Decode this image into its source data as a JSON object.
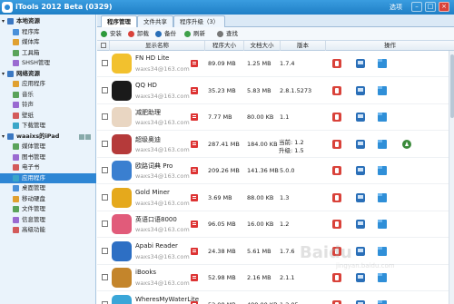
{
  "window": {
    "title": "iTools 2012 Beta (0329)",
    "options_label": "选项",
    "min_label": "–",
    "max_label": "□",
    "close_label": "×"
  },
  "sidebar": {
    "groups": [
      {
        "label": "本地资源",
        "items": [
          "程序库",
          "媒体库",
          "工具箱",
          "SHSH管理"
        ]
      },
      {
        "label": "网络资源",
        "items": [
          "应用程序",
          "音乐",
          "铃声",
          "壁纸",
          "下载管理"
        ]
      },
      {
        "label": "waaixs的iPad",
        "items": [
          "媒体管理",
          "图书管理",
          "电子书",
          "应用程序",
          "桌面管理",
          "移动硬盘",
          "文件管理",
          "信息管理",
          "高级功能"
        ]
      }
    ],
    "selected": "应用程序"
  },
  "tabs": [
    {
      "label": "程序管理",
      "active": true
    },
    {
      "label": "文件共享",
      "active": false
    },
    {
      "label": "程序升级（3）",
      "active": false
    }
  ],
  "toolbar": [
    {
      "label": "安装",
      "icon": "install-icon",
      "color": "#2e9a3a"
    },
    {
      "label": "卸载",
      "icon": "uninstall-icon",
      "color": "#d9423a"
    },
    {
      "label": "备份",
      "icon": "backup-icon",
      "color": "#2a6fb8"
    },
    {
      "label": "刷新",
      "icon": "refresh-icon",
      "color": "#3fa14a"
    },
    {
      "label": "查找",
      "icon": "search-icon",
      "color": "#777777"
    }
  ],
  "columns": [
    "显示名称",
    "程序大小",
    "文档大小",
    "版本",
    "操作"
  ],
  "apps": [
    {
      "name": "FN HD Lite",
      "account": "waxs34@163.com",
      "program_size": "89.09 MB",
      "doc_size": "1.25 MB",
      "version": "1.7.4",
      "version2": "",
      "upgrade": false,
      "icon_color": "#f2c12e"
    },
    {
      "name": "QQ HD",
      "account": "waxs34@163.com",
      "program_size": "35.23 MB",
      "doc_size": "5.83 MB",
      "version": "2.8.1.5273",
      "version2": "",
      "upgrade": false,
      "icon_color": "#1a1a1a"
    },
    {
      "name": "减肥助理",
      "account": "waxs34@163.com",
      "program_size": "7.77 MB",
      "doc_size": "80.00 KB",
      "version": "1.1",
      "version2": "",
      "upgrade": false,
      "icon_color": "#e9d6c2"
    },
    {
      "name": "超级奥迪",
      "account": "waxs34@163.com",
      "program_size": "287.41 MB",
      "doc_size": "184.00 KB",
      "version": "当前: 1.2",
      "version2": "升级: 1.5",
      "upgrade": true,
      "icon_color": "#b53a3a"
    },
    {
      "name": "欧路词典 Pro",
      "account": "waxs34@163.com",
      "program_size": "209.26 MB",
      "doc_size": "141.36 MB",
      "version": "5.0.0",
      "version2": "",
      "upgrade": false,
      "icon_color": "#3a7fd0"
    },
    {
      "name": "Gold Miner",
      "account": "waxs34@163.com",
      "program_size": "3.69 MB",
      "doc_size": "88.00 KB",
      "version": "1.3",
      "version2": "",
      "upgrade": false,
      "icon_color": "#e5a91c"
    },
    {
      "name": "英语口语8000",
      "account": "waxs34@163.com",
      "program_size": "96.05 MB",
      "doc_size": "16.00 KB",
      "version": "1.2",
      "version2": "",
      "upgrade": false,
      "icon_color": "#e15b7a"
    },
    {
      "name": "Apabi Reader",
      "account": "waxs34@163.com",
      "program_size": "24.38 MB",
      "doc_size": "5.61 MB",
      "version": "1.7.6",
      "version2": "",
      "upgrade": false,
      "icon_color": "#2d6fc4"
    },
    {
      "name": "iBooks",
      "account": "waxs34@163.com",
      "program_size": "52.98 MB",
      "doc_size": "2.16 MB",
      "version": "2.1.1",
      "version2": "",
      "upgrade": false,
      "icon_color": "#c4852b"
    },
    {
      "name": "WheresMyWaterLite",
      "account": "waxs34@163.com",
      "program_size": "52.98 MB",
      "doc_size": "488.00 KB",
      "version": "1.2.05",
      "version2": "",
      "upgrade": false,
      "icon_color": "#3aa6d8"
    }
  ],
  "watermark": {
    "main": "Baidu",
    "sub": "jingyan.baidu.com"
  }
}
